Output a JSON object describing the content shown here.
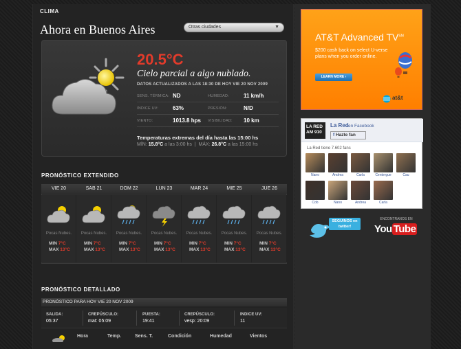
{
  "header": {
    "section": "CLIMA",
    "location": "Ahora en Buenos Aires",
    "select_label": "Otras ciudades"
  },
  "current": {
    "temperature": "20.5°C",
    "condition": "Cielo parcial a algo nublado.",
    "updated": "DATOS ACTUALIZADOS A LAS 18:30 DE HOY VIE 20 NOV 2009",
    "details": [
      {
        "label": "SENS. TÉRMICA:",
        "value": "ND"
      },
      {
        "label": "HUMEDAD:",
        "value": "11 km/h"
      },
      {
        "label": "INDICE UV:",
        "value": "63%"
      },
      {
        "label": "PRESIÓN:",
        "value": "N/D"
      },
      {
        "label": "VIENTO:",
        "value": "1013.8 hps"
      },
      {
        "label": "VISIBILIDAD:",
        "value": "10 km"
      }
    ],
    "extremes_title": "Temperaturas extremas del día hasta las 15:00 hs",
    "extremes": {
      "min_label": "MÍN:",
      "min_value": "15.8°C",
      "min_time": "a las 3:00 hs",
      "max_label": "MÁX:",
      "max_value": "26.8°C",
      "max_time": "a las 15:00 hs"
    }
  },
  "extended": {
    "title": "PRONÓSTICO EXTENDIDO",
    "min_label": "MIN",
    "max_label": "MAX",
    "days": [
      {
        "day": "VIE 20",
        "icon": "partly-cloudy-icon",
        "cond": "Pocas Nubes.",
        "min": "7°C",
        "max": "13°C"
      },
      {
        "day": "SAB 21",
        "icon": "partly-cloudy-icon",
        "cond": "Pocas Nubes.",
        "min": "7°C",
        "max": "13°C"
      },
      {
        "day": "DOM 22",
        "icon": "sun-rain-icon",
        "cond": "Pocas Nubes.",
        "min": "7°C",
        "max": "13°C"
      },
      {
        "day": "LUN 23",
        "icon": "storm-icon",
        "cond": "Pocas Nubes.",
        "min": "7°C",
        "max": "13°C"
      },
      {
        "day": "MAR 24",
        "icon": "rain-icon",
        "cond": "Pocas Nubes.",
        "min": "7°C",
        "max": "13°C"
      },
      {
        "day": "MIE 25",
        "icon": "rain-icon",
        "cond": "Pocas Nubes.",
        "min": "7°C",
        "max": "13°C"
      },
      {
        "day": "JUE 26",
        "icon": "rain-icon",
        "cond": "Pocas Nubes.",
        "min": "7°C",
        "max": "13°C"
      }
    ]
  },
  "detailed": {
    "title": "PRONÓSTICO DETALLADO",
    "bar": "PRONÓSTICO PARA HOY VIE 20 NOV 2009",
    "sun": [
      {
        "label": "SALIDA:",
        "value": "05:37"
      },
      {
        "label": "CREPÚSCULO:",
        "value": "mat: 05:09"
      },
      {
        "label": "PUESTA:",
        "value": "19:41"
      },
      {
        "label": "CREPÚSCULO:",
        "value": "vesp: 20:09"
      },
      {
        "label": "INDICE UV:",
        "value": "11"
      }
    ],
    "columns": [
      "Hora",
      "Temp.",
      "Sens. T.",
      "Condición",
      "Humedad",
      "Vientos"
    ]
  },
  "ad": {
    "title": "AT&T Advanced TV",
    "sm": "SM",
    "body": "$200 cash back on select U-verse plans when you order online.",
    "button": "LEARN MORE ›",
    "logo": "at&t"
  },
  "facebook": {
    "logo_line1": "LA RED",
    "logo_line2": "AM 910",
    "name": "La Red",
    "on": "en Facebook",
    "fan_button": "Hazte fan",
    "count": "La Red tiene 7.602 fans",
    "fans": [
      {
        "name": "Nano",
        "color": "#b58b5a"
      },
      {
        "name": "Andrea",
        "color": "#5a4030"
      },
      {
        "name": "Carla",
        "color": "#7a5a40"
      },
      {
        "name": "Centergue",
        "color": "#a8906c"
      },
      {
        "name": "Cau",
        "color": "#8f7050"
      },
      {
        "name": "Cob",
        "color": "#3e3028"
      },
      {
        "name": "Nano",
        "color": "#c9a57a"
      },
      {
        "name": "Andrea",
        "color": "#6b4a3a"
      },
      {
        "name": "Carla",
        "color": "#9a6b4d"
      }
    ]
  },
  "social": {
    "twitter_bubble": "SEGUINOS en twitter!",
    "youtube_label": "ENCONTRANOS EN",
    "youtube_you": "You",
    "youtube_tube": "Tube"
  }
}
